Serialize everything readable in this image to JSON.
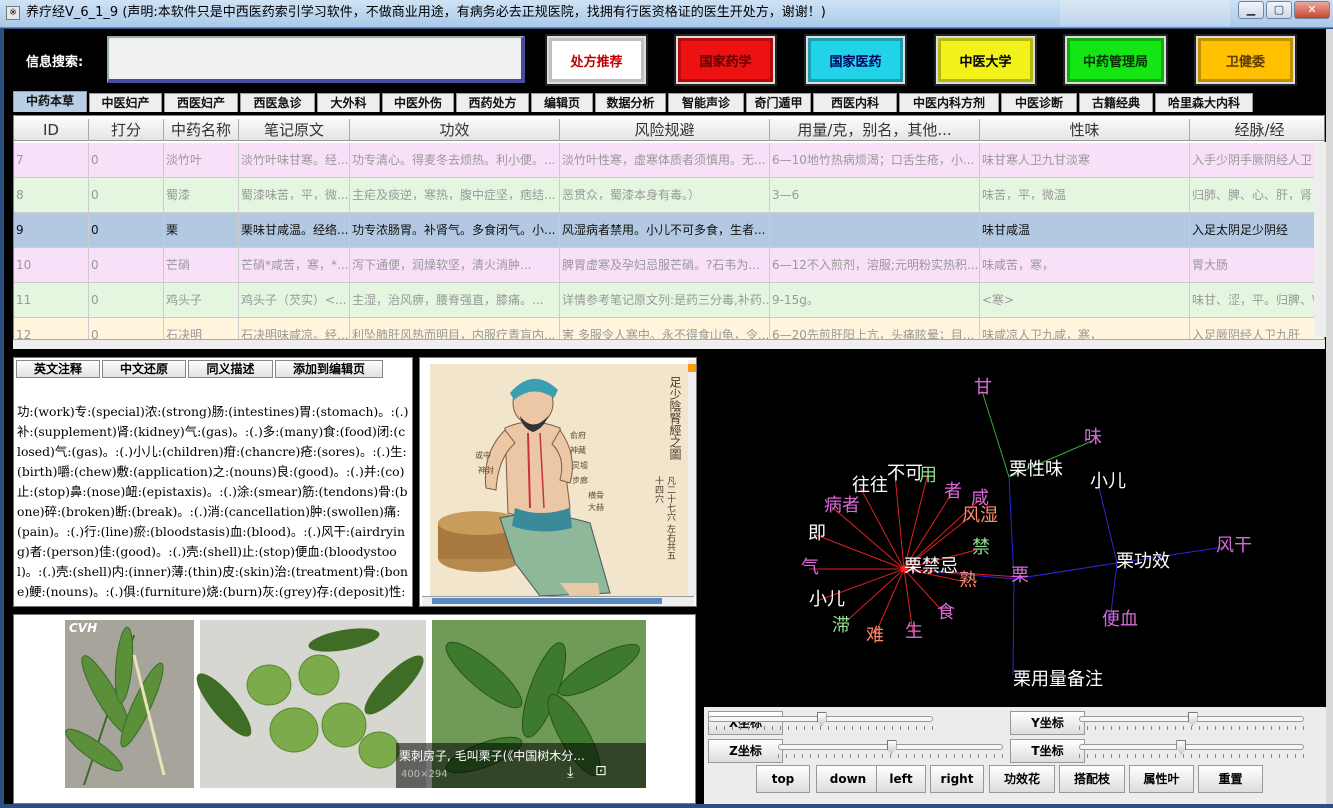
{
  "window": {
    "title": "养疗经V_6_1_9 (声明:本软件只是中西医药索引学习软件，不做商业用途，有病务必去正规医院，找拥有行医资格证的医生开处方，谢谢！)"
  },
  "search": {
    "label": "信息搜索:",
    "value": ""
  },
  "top_buttons": [
    {
      "label": "处方推荐",
      "color": "#ffffff",
      "text_color": "#c00000"
    },
    {
      "label": "国家药学",
      "color": "#ee1111",
      "text_color": "#660000"
    },
    {
      "label": "国家医药",
      "color": "#22d3e8",
      "text_color": "#000066"
    },
    {
      "label": "中医大学",
      "color": "#f2f21a",
      "text_color": "#000000"
    },
    {
      "label": "中药管理局",
      "color": "#13e613",
      "text_color": "#003300"
    },
    {
      "label": "卫健委",
      "color": "#ffc000",
      "text_color": "#5a3a00"
    }
  ],
  "tabs": [
    "中药本草",
    "中医妇产",
    "西医妇产",
    "西医急诊",
    "大外科",
    "中医外伤",
    "西药处方",
    "编辑页",
    "数据分析",
    "智能声诊",
    "奇门遁甲",
    "西医内科",
    "中医内科方剂",
    "中医诊断",
    "古籍经典",
    "哈里森大内科"
  ],
  "active_tab": "中药本草",
  "grid": {
    "columns": [
      "ID",
      "打分",
      "中药名称",
      "笔记原文",
      "功效",
      "风险规避",
      "用量/克，别名，其他...",
      "性味",
      "经脉/经"
    ],
    "rows": [
      {
        "bg": "#f8e0f8",
        "cells": [
          "7",
          "0",
          "淡竹叶",
          "淡竹叶味甘寒。经...",
          "功专清心。得麦冬去烦热。利小便。...",
          "淡竹叶性寒，虚寒体质者须慎用。无...",
          "6—10地竹热病烦渴；口舌生疮，小...",
          "味甘寒人卫九甘淡寒",
          "入手少阴手厥阴经人卫"
        ]
      },
      {
        "bg": "#e4f6e0",
        "cells": [
          "8",
          "0",
          "蜀漆",
          "蜀漆味苦，平，微...",
          "主疟及痰逆，寒热，腹中症坚，痞结...",
          "恶贯众，蜀漆本身有毒。）",
          "3—6",
          "味苦，平，微温",
          "归肺、脾、心、肝，肾"
        ]
      },
      {
        "bg": "#b3c9e1",
        "sel": true,
        "cells": [
          "9",
          "0",
          "栗",
          "栗味甘咸温。经络...",
          "功专浓肠胃。补肾气。多食闭气。小...",
          "风湿病者禁用。小儿不可多食，生者...",
          "",
          "味甘咸温",
          "入足太阴足少阴经"
        ]
      },
      {
        "bg": "#f8e0f8",
        "cells": [
          "10",
          "0",
          "芒硝",
          "芒硝*咸苦，寒，*...",
          "泻下通便，润燥软坚，清火消肿...",
          "脾胃虚寒及孕妇忌服芒硝。?石韦为...",
          "6—12不入煎剂，溶服;元明粉实热积...",
          "味咸苦，寒，",
          "胃大肠"
        ]
      },
      {
        "bg": "#e4f6e0",
        "cells": [
          "11",
          "0",
          "鸡头子",
          "鸡头子（芡实）<...",
          "主湿，治风痹，腰脊强直，膝痛。...",
          "详情参考笔记原文列:是药三分毒,补药...",
          "9-15g。",
          "<寒>",
          "味甘、涩，平。归脾、\\"
        ]
      },
      {
        "bg": "#fff5dc",
        "cells": [
          "12",
          "0",
          "石决明",
          "石决明味咸凉。经...",
          "利坠肺肝风热而明目，内服疗青盲内...",
          "害 多服令人寒中。永不得食山龟，令...",
          "6—20先煎肝阳上亢，头痛眩晕；目...",
          "味咸凉人卫九咸，寒，",
          "入足厥阴经人卫九肝"
        ]
      }
    ]
  },
  "annot_buttons": [
    "英文注释",
    "中文还原",
    "同义描述",
    "添加到编辑页"
  ],
  "annotation_text": "功:(work)专:(special)浓:(strong)肠:(intestines)胃:(stomach)。:(.)补:(supplement)肾:(kidney)气:(gas)。:(.)多:(many)食:(food)闭:(closed)气:(gas)。:(.)小儿:(children)疳:(chancre)疮:(sores)。:(.)生:(birth)嚼:(chew)敷:(application)之:(nouns)良:(good)。:(.)并:(co)止:(stop)鼻:(nose)衄:(epistaxis)。:(.)涂:(smear)筋:(tendons)骨:(bone)碎:(broken)断:(break)。:(.)消:(cancellation)肿:(swollen)痛:(pain)。:(.)行:(line)瘀:(bloodstasis)血:(blood)。:(.)风干:(airdrying)者:(person)佳:(good)。:(.)壳:(shell)止:(stop)便血:(bloodystool)。:(.)壳:(shell)内:(inner)薄:(thin)皮:(skin)治:(treatment)骨:(bone)鲠:(nouns)。:(.)俱:(furniture)烧:(burn)灰:(grey)存:(deposit)性:(sex)用:(use)。:(.)",
  "meridian_chart": {
    "title": "足少陰腎經之圖",
    "subtitle": "凡二十七穴 左右共五十四穴"
  },
  "photos": {
    "watermark": "CVH",
    "caption": "栗刺房子, 毛叫栗子(《中国树木分...",
    "size_text": "400×294"
  },
  "graph": {
    "nodes": [
      "甘",
      "味",
      "栗性味",
      "小儿",
      "不可",
      "往往",
      "用",
      "者",
      "咸",
      "病者",
      "风湿",
      "即",
      "禁",
      "栗禁忌",
      "栗",
      "栗功效",
      "风干",
      "气",
      "熟",
      "小儿",
      "食",
      "滞",
      "难",
      "生",
      "便血",
      "栗用量备注"
    ]
  },
  "controls": {
    "sliders": [
      {
        "label": "X坐标",
        "value": 0.5
      },
      {
        "label": "Y坐标",
        "value": 0.5
      },
      {
        "label": "Z坐标",
        "value": 0.5
      },
      {
        "label": "T坐标",
        "value": 0.45
      }
    ],
    "nav_buttons": [
      "top",
      "down",
      "left",
      "right",
      "功效花",
      "搭配枝",
      "属性叶",
      "重置"
    ]
  }
}
